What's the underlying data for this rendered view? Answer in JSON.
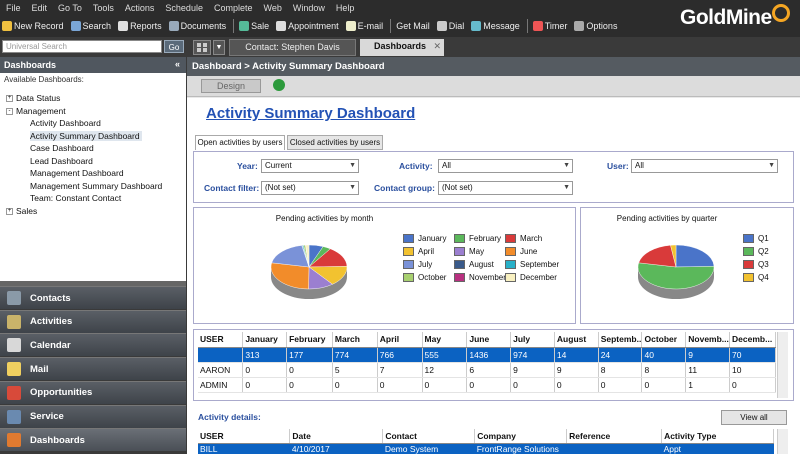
{
  "menu": [
    "File",
    "Edit",
    "Go To",
    "Tools",
    "Actions",
    "Schedule",
    "Complete",
    "Web",
    "Window",
    "Help"
  ],
  "toolbar": [
    {
      "label": "New Record",
      "color": "#f0c040"
    },
    {
      "label": "Search",
      "color": "#7aa6d6"
    },
    {
      "label": "Reports",
      "color": "#e0e0e0"
    },
    {
      "label": "Documents",
      "color": "#9ab"
    },
    {
      "label": "Sale",
      "color": "#5b9"
    },
    {
      "label": "Appointment",
      "color": "#ddd"
    },
    {
      "label": "E-mail",
      "color": "#eec"
    },
    {
      "label": "Get Mail",
      "color": ""
    },
    {
      "label": "Dial",
      "color": "#ccc"
    },
    {
      "label": "Message",
      "color": "#6bc"
    },
    {
      "label": "Timer",
      "color": "#e55"
    },
    {
      "label": "Options",
      "color": "#aaa"
    }
  ],
  "logo": "GoldMine",
  "search": {
    "placeholder": "Universal Search",
    "go": "Go"
  },
  "tabs": {
    "contact": "Contact: Stephen Davis",
    "dashboards": "Dashboards"
  },
  "left": {
    "title": "Dashboards",
    "available": "Available Dashboards:",
    "tree": [
      {
        "label": "Data Status",
        "level": 0,
        "pm": "+"
      },
      {
        "label": "Management",
        "level": 0,
        "pm": "-"
      },
      {
        "label": "Activity Dashboard",
        "level": 1
      },
      {
        "label": "Activity Summary Dashboard",
        "level": 1,
        "selected": true
      },
      {
        "label": "Case Dashboard",
        "level": 1
      },
      {
        "label": "Lead Dashboard",
        "level": 1
      },
      {
        "label": "Management Dashboard",
        "level": 1
      },
      {
        "label": "Management Summary Dashboard",
        "level": 1
      },
      {
        "label": "Team: Constant Contact",
        "level": 1
      },
      {
        "label": "Sales",
        "level": 0,
        "pm": "+"
      }
    ],
    "nav": [
      {
        "label": "Contacts",
        "color": "#8a9aa8"
      },
      {
        "label": "Activities",
        "color": "#c9b36a"
      },
      {
        "label": "Calendar",
        "color": "#d8d8d8"
      },
      {
        "label": "Mail",
        "color": "#f0d060"
      },
      {
        "label": "Opportunities",
        "color": "#d84a3a"
      },
      {
        "label": "Service",
        "color": "#6a8ab0"
      },
      {
        "label": "Dashboards",
        "color": "#e07a30"
      }
    ]
  },
  "breadcrumb": "Dashboard > Activity Summary Dashboard",
  "design_label": "Design",
  "page_title": "Activity Summary Dashboard",
  "inner_tabs": [
    "Open activities by users",
    "Closed activities by users"
  ],
  "filters": {
    "year_label": "Year:",
    "year_value": "Current",
    "activity_label": "Activity:",
    "activity_value": "All",
    "user_label": "User:",
    "user_value": "All",
    "contact_filter_label": "Contact filter:",
    "contact_filter_value": "(Not set)",
    "contact_group_label": "Contact group:",
    "contact_group_value": "(Not set)"
  },
  "chart_data": [
    {
      "type": "pie",
      "title": "Pending activities by month",
      "categories": [
        "January",
        "February",
        "March",
        "April",
        "May",
        "June",
        "July",
        "August",
        "September",
        "October",
        "November",
        "December"
      ],
      "values": [
        313,
        177,
        774,
        766,
        555,
        1436,
        974,
        14,
        24,
        40,
        9,
        70
      ],
      "colors": [
        "#4a74c9",
        "#5bb85b",
        "#d93a3a",
        "#f2c230",
        "#9b7fd0",
        "#f28c2a",
        "#7a92d8",
        "#3a5a8a",
        "#28b0c8",
        "#a8d070",
        "#b83080",
        "#f8f0c0"
      ]
    },
    {
      "type": "pie",
      "title": "Pending activities by quarter",
      "categories": [
        "Q1",
        "Q2",
        "Q3",
        "Q4"
      ],
      "values": [
        1264,
        2757,
        1012,
        119
      ],
      "colors": [
        "#4a74c9",
        "#5bb85b",
        "#d93a3a",
        "#f2c230"
      ]
    }
  ],
  "table": {
    "headers": [
      "USER",
      "January",
      "February",
      "March",
      "April",
      "May",
      "June",
      "July",
      "August",
      "Septemb...",
      "October",
      "Novemb...",
      "Decemb..."
    ],
    "rows": [
      [
        "",
        "313",
        "177",
        "774",
        "766",
        "555",
        "1436",
        "974",
        "14",
        "24",
        "40",
        "9",
        "70"
      ],
      [
        "AARON",
        "0",
        "0",
        "5",
        "7",
        "12",
        "6",
        "9",
        "9",
        "8",
        "8",
        "11",
        "10"
      ],
      [
        "ADMIN",
        "0",
        "0",
        "0",
        "0",
        "0",
        "0",
        "0",
        "0",
        "0",
        "0",
        "1",
        "0"
      ]
    ]
  },
  "details": {
    "label": "Activity details:",
    "view_all": "View all",
    "headers": [
      "USER",
      "Date",
      "Contact",
      "Company",
      "Reference",
      "Activity Type"
    ],
    "row": [
      "BILL",
      "4/10/2017",
      "Demo System",
      "FrontRange Solutions",
      "",
      "Appt"
    ]
  }
}
